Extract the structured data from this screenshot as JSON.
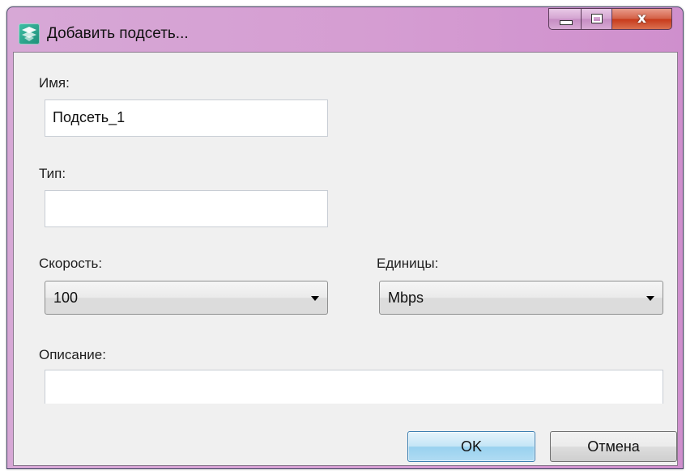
{
  "window": {
    "title": "Добавить подсеть...",
    "close_glyph": "x"
  },
  "form": {
    "name_label": "Имя:",
    "name_value": "Подсеть_1",
    "type_label": "Тип:",
    "type_value": "",
    "speed_label": "Скорость:",
    "speed_value": "100",
    "units_label": "Единицы:",
    "units_value": "Mbps",
    "description_label": "Описание:",
    "description_value": ""
  },
  "buttons": {
    "ok_label": "OK",
    "cancel_label": "Отмена"
  },
  "icons": {
    "app": "network-app-icon",
    "minimize": "minimize-icon",
    "maximize": "maximize-icon",
    "close": "close-icon",
    "dropdown": "chevron-down-icon"
  },
  "colors": {
    "titlebar": "#d59dd2",
    "client_bg": "#f0f0f0",
    "ok_button": "#98d1ef",
    "close_button": "#c7391a"
  }
}
